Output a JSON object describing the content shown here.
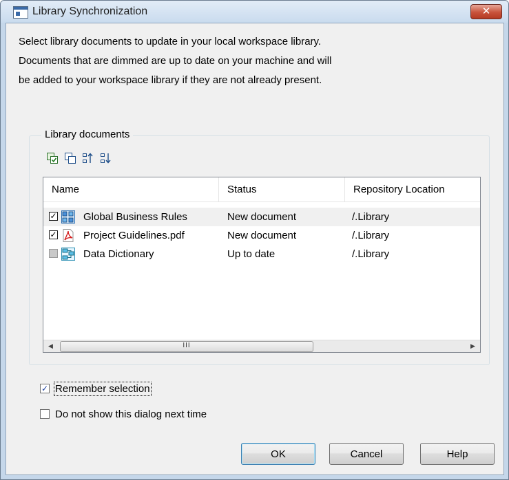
{
  "window": {
    "title": "Library Synchronization",
    "close_glyph": "✕"
  },
  "intro": {
    "line1": "Select library documents to update in your local workspace library.",
    "line2": "Documents that are dimmed are up to date on your machine and will",
    "line3": "be added to your workspace library if they are not already present."
  },
  "group": {
    "label": "Library documents",
    "toolbar": [
      {
        "icon": "select-all-icon"
      },
      {
        "icon": "deselect-all-icon"
      },
      {
        "icon": "sort-ascending-icon"
      },
      {
        "icon": "sort-descending-icon"
      }
    ]
  },
  "table": {
    "columns": [
      "Name",
      "Status",
      "Repository Location"
    ],
    "rows": [
      {
        "name": "Global Business Rules",
        "status": "New document",
        "location": "/.Library",
        "checked": true,
        "icon": "business-rules-icon"
      },
      {
        "name": "Project Guidelines.pdf",
        "status": "New document",
        "location": "/.Library",
        "checked": true,
        "icon": "pdf-icon"
      },
      {
        "name": "Data Dictionary",
        "status": "Up to date",
        "location": "/.Library",
        "checked": false,
        "dimmed": true,
        "icon": "data-dictionary-icon"
      }
    ],
    "scroll_grip": "III"
  },
  "options": {
    "remember_selection": {
      "label": "Remember selection",
      "checked": true
    },
    "do_not_show": {
      "label": "Do not show this dialog next time",
      "checked": false
    }
  },
  "buttons": {
    "ok": "OK",
    "cancel": "Cancel",
    "help": "Help"
  },
  "glyphs": {
    "check": "✓",
    "left_arrow": "◀",
    "right_arrow": "▶"
  },
  "colors": {
    "accent": "#3c7fb1",
    "close": "#c8523b",
    "frame": "#c5d7ea"
  }
}
